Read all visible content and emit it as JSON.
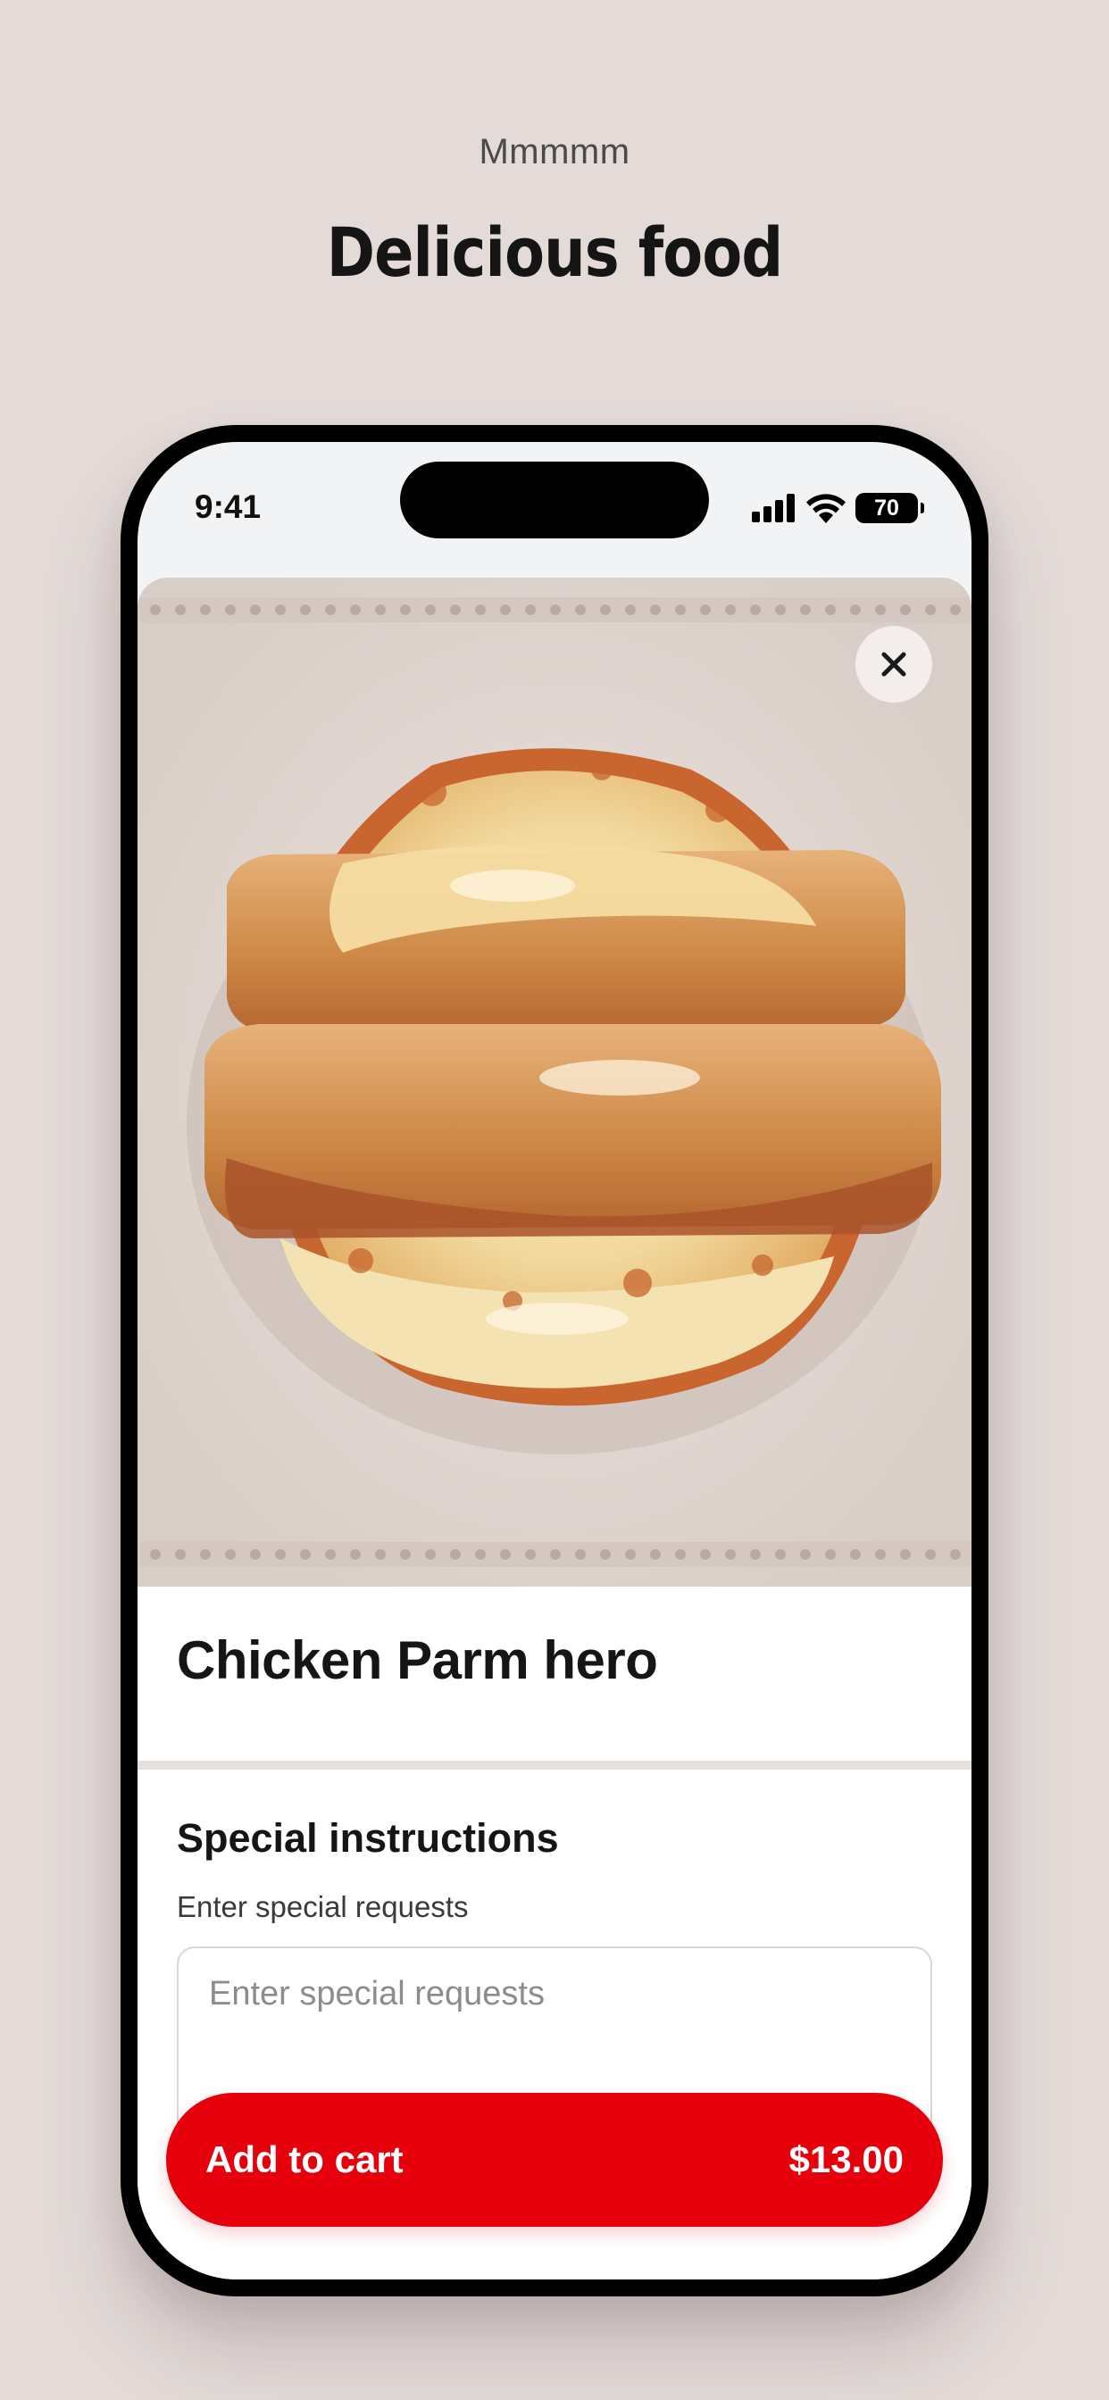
{
  "promo": {
    "eyebrow": "Mmmmm",
    "headline": "Delicious food"
  },
  "status_bar": {
    "time": "9:41",
    "battery": "70",
    "icons": [
      "signal-icon",
      "wifi-icon",
      "battery-icon"
    ]
  },
  "product": {
    "image": "chicken-parm-hero-photo",
    "close_icon": "close-icon",
    "name": "Chicken Parm hero"
  },
  "special_instructions": {
    "title": "Special instructions",
    "subtitle": "Enter special requests",
    "placeholder": "Enter special requests",
    "value": ""
  },
  "cart_button": {
    "label": "Add to cart",
    "price": "$13.00"
  },
  "colors": {
    "page_background": "#e4dbd9",
    "accent_red": "#e5000b",
    "text_dark": "#151515"
  }
}
